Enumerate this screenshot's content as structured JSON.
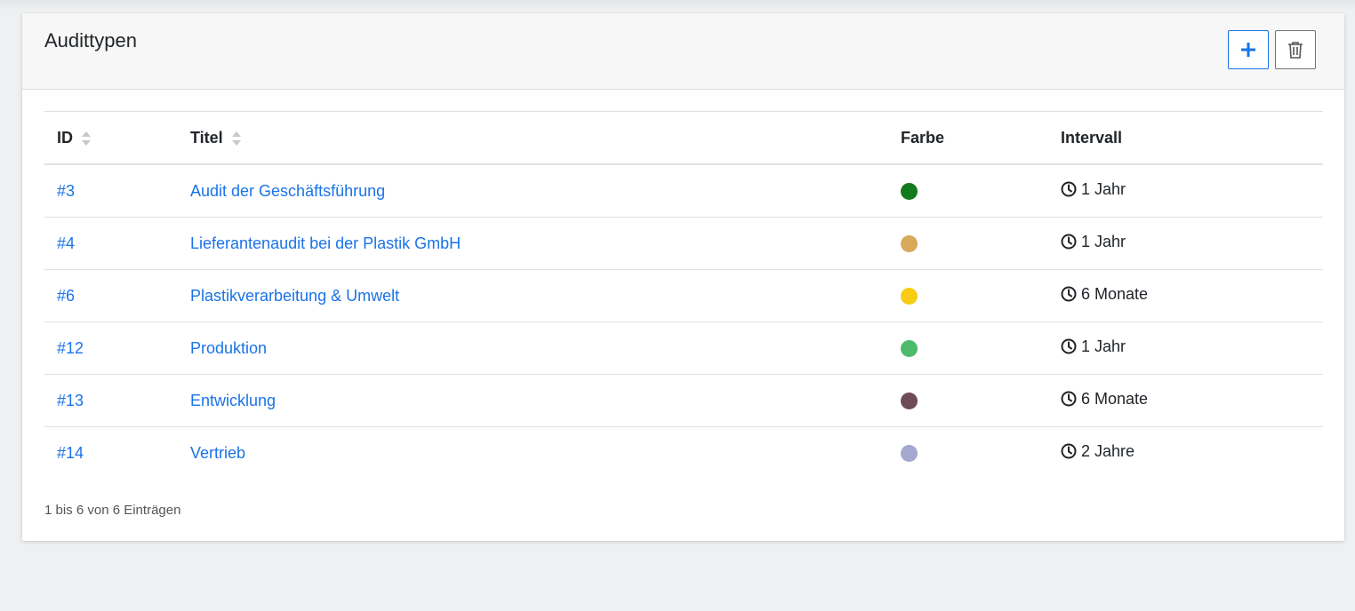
{
  "card": {
    "title": "Audittypen"
  },
  "columns": {
    "id": "ID",
    "title": "Titel",
    "color": "Farbe",
    "interval": "Intervall"
  },
  "rows": [
    {
      "id": "#3",
      "title": "Audit der Geschäftsführung",
      "color": "#127a1c",
      "interval": "1 Jahr"
    },
    {
      "id": "#4",
      "title": "Lieferantenaudit bei der Plastik GmbH",
      "color": "#d9a95b",
      "interval": "1 Jahr"
    },
    {
      "id": "#6",
      "title": "Plastikverarbeitung & Umwelt",
      "color": "#f6cd14",
      "interval": "6 Monate"
    },
    {
      "id": "#12",
      "title": "Produktion",
      "color": "#4dba6c",
      "interval": "1 Jahr"
    },
    {
      "id": "#13",
      "title": "Entwicklung",
      "color": "#6e4b57",
      "interval": "6 Monate"
    },
    {
      "id": "#14",
      "title": "Vertrieb",
      "color": "#a4a8cf",
      "interval": "2 Jahre"
    }
  ],
  "footer": {
    "info": "1 bis 6 von 6 Einträgen"
  },
  "colors": {
    "accent": "#1a73e8",
    "secondary": "#6c757d"
  },
  "icons": {
    "add": "plus-icon",
    "delete": "trash-icon",
    "sort": "sort-icon",
    "interval": "clock-icon"
  }
}
